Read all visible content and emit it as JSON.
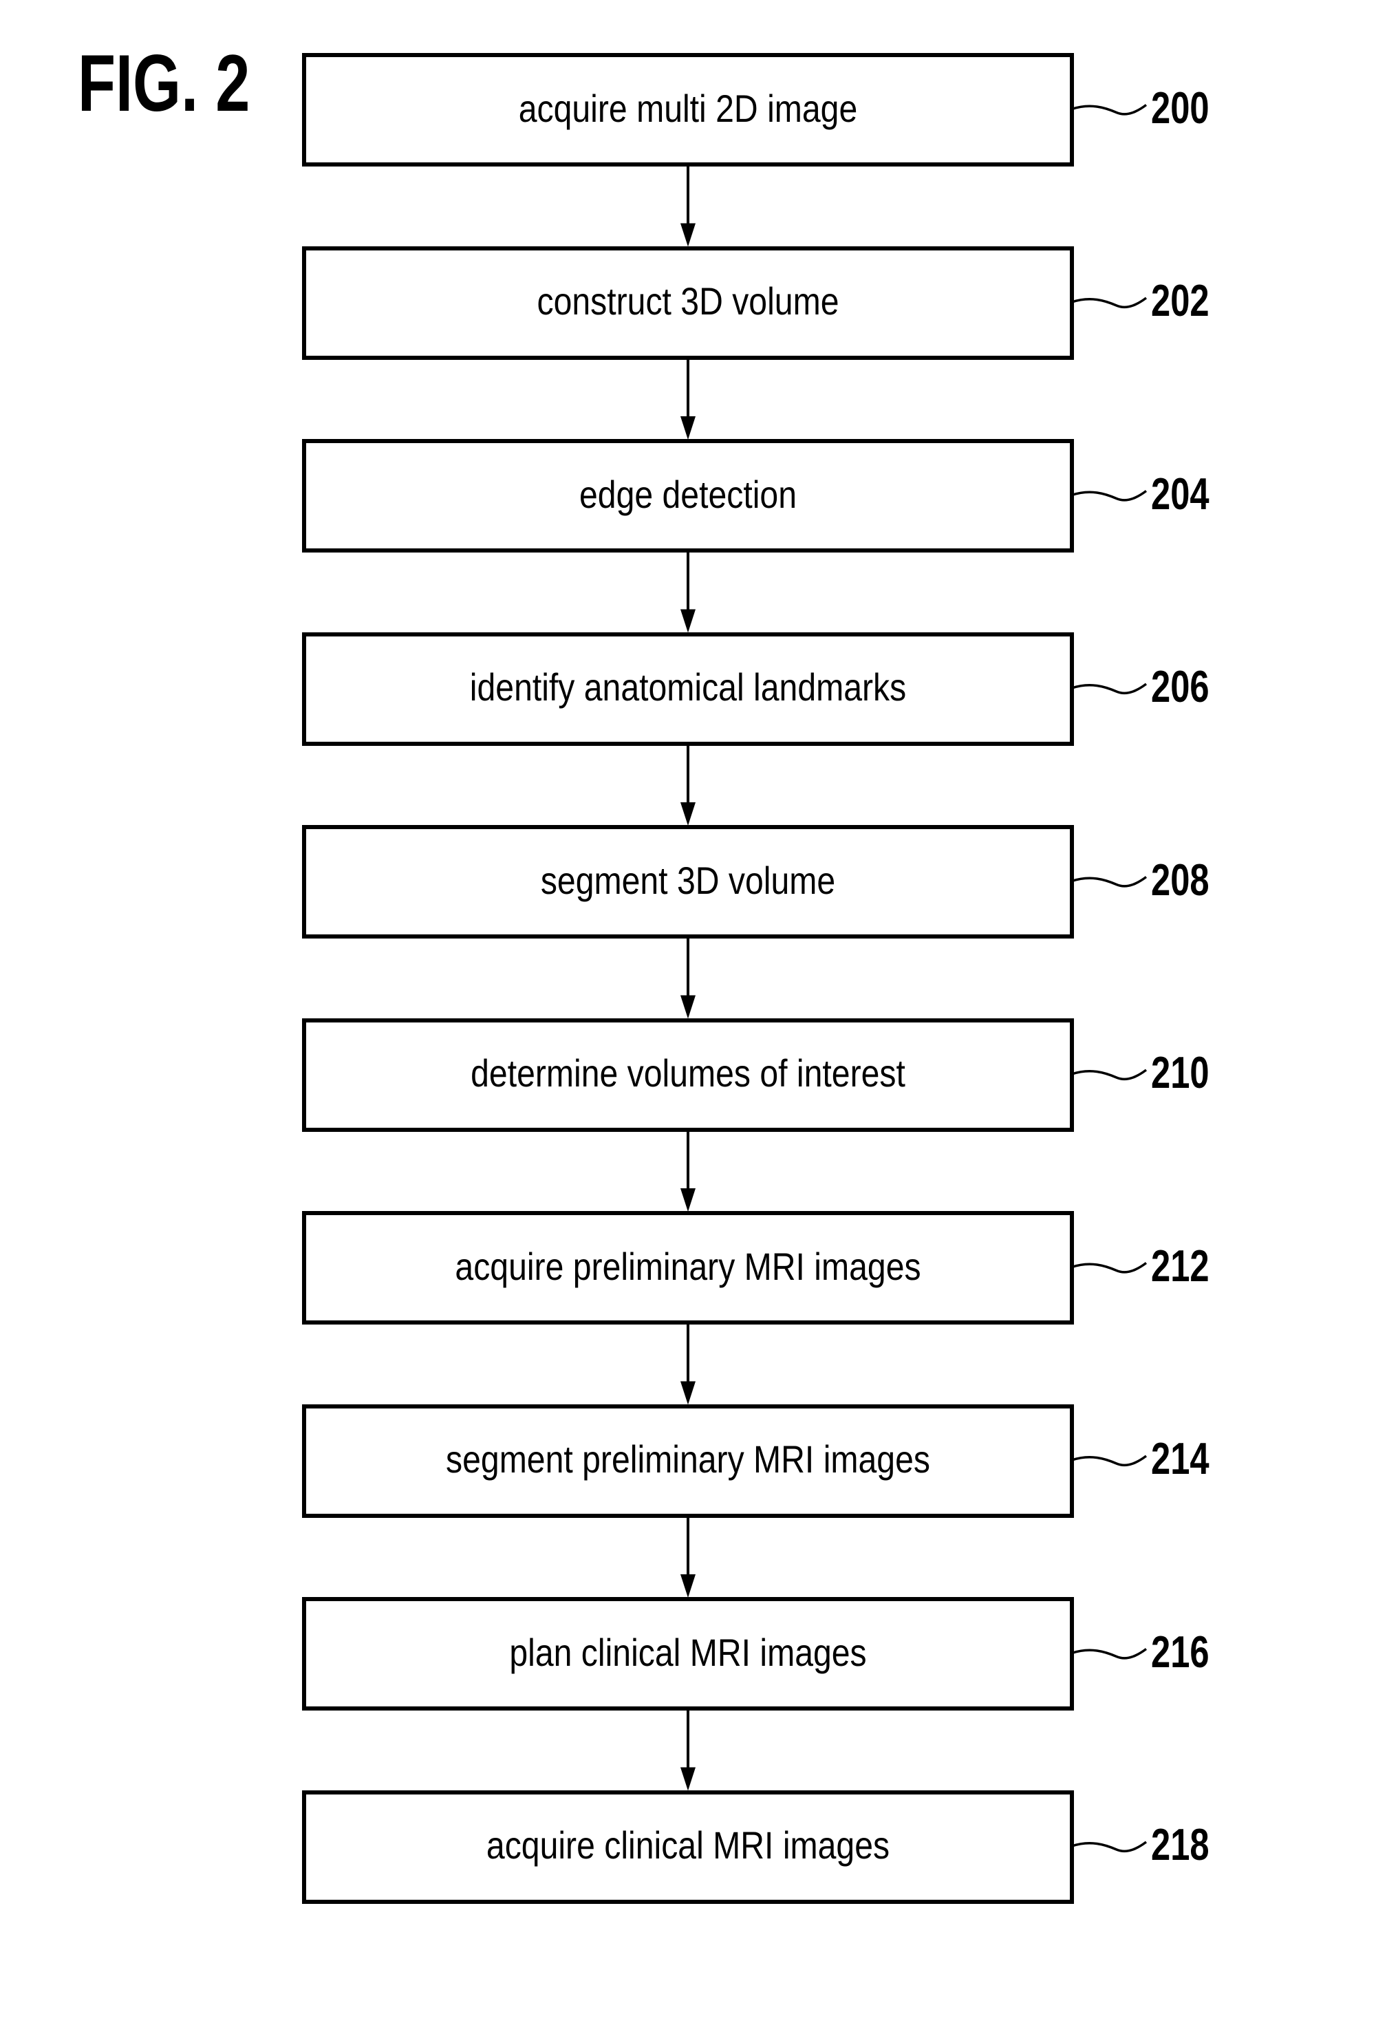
{
  "figure": {
    "title": "FIG. 2"
  },
  "steps": [
    {
      "label": "acquire multi 2D image",
      "ref": "200"
    },
    {
      "label": "construct 3D volume",
      "ref": "202"
    },
    {
      "label": "edge detection",
      "ref": "204"
    },
    {
      "label": "identify anatomical landmarks",
      "ref": "206"
    },
    {
      "label": "segment 3D volume",
      "ref": "208"
    },
    {
      "label": "determine volumes of interest",
      "ref": "210"
    },
    {
      "label": "acquire preliminary MRI images",
      "ref": "212"
    },
    {
      "label": "segment preliminary MRI images",
      "ref": "214"
    },
    {
      "label": "plan clinical MRI images",
      "ref": "216"
    },
    {
      "label": "acquire clinical MRI images",
      "ref": "218"
    }
  ],
  "connectors": {
    "style": "arrow-down",
    "count": 9
  },
  "colors": {
    "ink": "#000000",
    "paper": "#ffffff"
  }
}
